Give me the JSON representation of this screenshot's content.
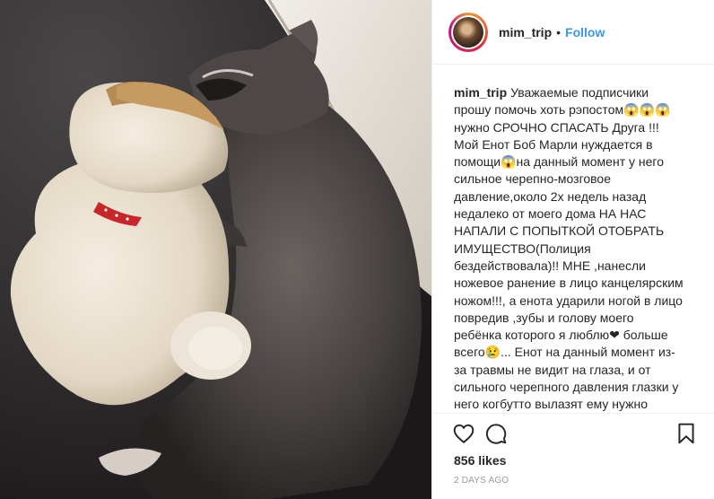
{
  "post": {
    "username": "mim_trip",
    "separator": "•",
    "follow_label": "Follow",
    "caption_username": "mim_trip",
    "caption_text": "Уважаемые подписчики прошу помочь хоть рэпостом😱😱😱 нужно СРОЧНО СПАСАТЬ Друга !!!Мой Енот Боб Марли нуждается в помощи😱на данный момент у него сильное черепно-мозговое давление,около 2х недель назад недалеко от моего дома  НА НАС НАПАЛИ С ПОПЫТКОЙ ОТОБРАТЬ ИМУЩЕСТВО(Полиция бездействовала)!! МНЕ ,нанесли ножевое ранение в лицо канцелярским ножом!!!, а енота ударили ногой в лицо повредив ,зубы и голову моего ребёнка которого я люблю❤ больше всего😢... Енот на данный момент из-за травмы не видит на глаза, и от сильного черепного давления  глазки у него когбутто вылазят  ему нужно срочно делать МРТ оно проводиться в человеческой больнице под местным наркозом, стоимость только одного МРТ 3000 (руб) и это не считая лечения😭Не",
    "likes": "856 likes",
    "time": "2 DAYS AGO"
  },
  "icons": {
    "like": "heart-icon",
    "comment": "comment-icon",
    "save": "bookmark-icon"
  },
  "colors": {
    "link_blue": "#3897f0",
    "text": "#262626",
    "muted": "#999999",
    "border": "#efefef"
  }
}
